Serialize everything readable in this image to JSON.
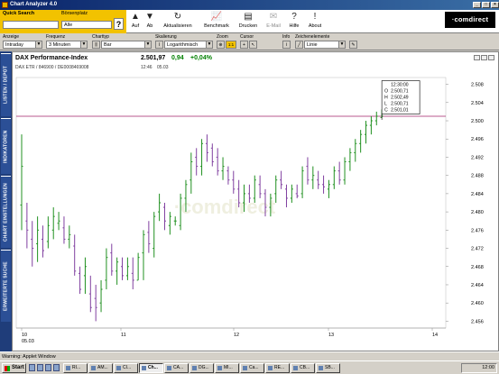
{
  "window": {
    "title": "Chart Analyzer 4.0"
  },
  "quicksearch": {
    "label": "Quick Search",
    "boersenplatz_label": "Börsenplatz",
    "search_value": "",
    "boersenplatz_value": "Alle",
    "help_label": "?"
  },
  "toolbar": {
    "buttons": [
      {
        "label": "Auf",
        "icon": "arrow-up-icon"
      },
      {
        "label": "Ab",
        "icon": "arrow-down-icon"
      },
      {
        "label": "Aktualisieren",
        "icon": "refresh-icon"
      },
      {
        "label": "Benchmark",
        "icon": "chart-icon"
      },
      {
        "label": "Drucken",
        "icon": "printer-icon"
      },
      {
        "label": "E-Mail",
        "icon": "email-icon"
      },
      {
        "label": "Hilfe",
        "icon": "help-icon"
      },
      {
        "label": "About",
        "icon": "about-icon"
      }
    ],
    "logo": "comdirect"
  },
  "settings": {
    "anzeige": {
      "label": "Anzeige",
      "value": "Intraday"
    },
    "frequenz": {
      "label": "Frequenz",
      "value": "3 Minuten"
    },
    "charttyp": {
      "label": "Charttyp",
      "value": "Bar"
    },
    "skalierung": {
      "label": "Skalierung",
      "value": "Logarithmisch"
    },
    "zoom": {
      "label": "Zoom",
      "value": "1:1"
    },
    "cursor": {
      "label": "Cursor"
    },
    "info": {
      "label": "Info"
    },
    "zeichenelemente": {
      "label": "Zeichenelemente",
      "value": "Linie"
    }
  },
  "sidebar": {
    "tabs": [
      "LISTEN / DEPOT",
      "INDIKATOREN",
      "CHART EINSTELLUNGEN",
      "ERWEITERTE SUCHE"
    ]
  },
  "instrument": {
    "name": "DAX Performance-Index",
    "sub": "DAX ETR / 846900 / DE0008469008",
    "price": "2.501,97",
    "change_abs": "0,94",
    "change_pct": "+0,04%",
    "time": "12:46",
    "date": "05.03"
  },
  "chart_data": {
    "type": "ohlc-bar",
    "watermark": "comdirect",
    "x_tick_labels": [
      "10",
      "05.03",
      "11",
      "12",
      "13",
      "14"
    ],
    "y_tick_labels": [
      "2.508",
      "2.504",
      "2.500",
      "2.496",
      "2.492",
      "2.488",
      "2.484",
      "2.480",
      "2.476",
      "2.472",
      "2.468",
      "2.464",
      "2.460",
      "2.456"
    ],
    "ylim": [
      2454.5,
      2509.5
    ],
    "reference_line": 2501.0,
    "tooltip": {
      "time": "12:30:00",
      "o": "2.500,71",
      "h": "2.502,49",
      "l": "2.500,71",
      "c": "2.501,01",
      "o_label": "O",
      "h_label": "H",
      "l_label": "L",
      "c_label": "C"
    },
    "bars": [
      [
        2481.5,
        2497.0,
        2476.0,
        2490.0
      ],
      [
        2478.0,
        2482.0,
        2472.0,
        2476.0
      ],
      [
        2474.0,
        2478.0,
        2468.0,
        2472.0
      ],
      [
        2473.0,
        2479.0,
        2469.0,
        2476.0
      ],
      [
        2474.0,
        2477.0,
        2470.0,
        2471.5
      ],
      [
        2473.5,
        2479.0,
        2472.0,
        2477.0
      ],
      [
        2476.0,
        2481.0,
        2474.0,
        2479.0
      ],
      [
        2477.5,
        2480.0,
        2476.0,
        2478.0
      ],
      [
        2476.5,
        2479.0,
        2473.0,
        2474.0
      ],
      [
        2474.0,
        2477.0,
        2472.0,
        2475.0
      ],
      [
        2472.5,
        2475.0,
        2466.0,
        2467.0
      ],
      [
        2466.5,
        2468.0,
        2462.0,
        2463.0
      ],
      [
        2466.0,
        2470.0,
        2462.0,
        2468.0
      ],
      [
        2462.0,
        2466.0,
        2458.0,
        2459.0
      ],
      [
        2461.0,
        2464.0,
        2456.0,
        2459.0
      ],
      [
        2460.0,
        2465.0,
        2458.0,
        2463.0
      ],
      [
        2465.0,
        2472.0,
        2463.0,
        2470.0
      ],
      [
        2471.0,
        2473.0,
        2466.0,
        2467.0
      ],
      [
        2467.0,
        2470.0,
        2464.0,
        2469.0
      ],
      [
        2468.0,
        2470.0,
        2465.0,
        2466.0
      ],
      [
        2466.0,
        2470.0,
        2465.0,
        2468.0
      ],
      [
        2466.5,
        2470.0,
        2463.0,
        2465.0
      ],
      [
        2465.0,
        2471.0,
        2465.0,
        2470.0
      ],
      [
        2471.0,
        2476.0,
        2465.0,
        2475.0
      ],
      [
        2475.5,
        2478.0,
        2471.0,
        2473.0
      ],
      [
        2472.0,
        2480.0,
        2470.0,
        2479.0
      ],
      [
        2480.0,
        2484.0,
        2478.0,
        2482.0
      ],
      [
        2481.0,
        2482.0,
        2476.0,
        2478.0
      ],
      [
        2477.0,
        2480.0,
        2475.0,
        2479.0
      ],
      [
        2478.0,
        2479.0,
        2477.0,
        2478.0
      ],
      [
        2477.0,
        2484.0,
        2476.0,
        2483.0
      ],
      [
        2483.0,
        2487.0,
        2480.0,
        2486.0
      ],
      [
        2487.0,
        2493.0,
        2484.0,
        2491.0
      ],
      [
        2492.0,
        2494.0,
        2488.0,
        2490.0
      ],
      [
        2490.0,
        2496.0,
        2488.0,
        2495.0
      ],
      [
        2495.0,
        2497.0,
        2491.0,
        2493.0
      ],
      [
        2494.0,
        2495.0,
        2490.0,
        2491.0
      ],
      [
        2492.0,
        2494.0,
        2488.0,
        2489.0
      ],
      [
        2489.0,
        2492.0,
        2487.0,
        2490.0
      ],
      [
        2489.0,
        2490.0,
        2486.0,
        2487.0
      ],
      [
        2487.0,
        2489.0,
        2484.0,
        2485.0
      ],
      [
        2485.0,
        2487.0,
        2481.0,
        2482.0
      ],
      [
        2482.0,
        2486.0,
        2480.0,
        2484.0
      ],
      [
        2484.0,
        2486.0,
        2482.0,
        2483.0
      ],
      [
        2483.0,
        2488.0,
        2482.0,
        2487.0
      ],
      [
        2486.0,
        2488.0,
        2483.0,
        2484.0
      ],
      [
        2484.0,
        2485.0,
        2479.0,
        2481.0
      ],
      [
        2481.0,
        2484.0,
        2479.0,
        2483.0
      ],
      [
        2484.0,
        2488.0,
        2482.0,
        2487.0
      ],
      [
        2487.0,
        2489.0,
        2485.0,
        2486.0
      ],
      [
        2485.0,
        2486.0,
        2481.0,
        2483.0
      ],
      [
        2483.0,
        2486.0,
        2482.0,
        2485.0
      ],
      [
        2484.0,
        2486.0,
        2483.0,
        2483.5
      ],
      [
        2484.0,
        2490.0,
        2483.0,
        2489.0
      ],
      [
        2490.0,
        2492.0,
        2486.0,
        2487.0
      ],
      [
        2487.0,
        2490.0,
        2485.0,
        2488.0
      ],
      [
        2487.0,
        2489.0,
        2485.0,
        2486.0
      ],
      [
        2486.0,
        2488.0,
        2484.0,
        2485.5
      ],
      [
        2485.0,
        2487.0,
        2483.0,
        2486.0
      ],
      [
        2486.0,
        2490.0,
        2485.0,
        2489.0
      ],
      [
        2489.0,
        2491.0,
        2486.0,
        2487.0
      ],
      [
        2487.0,
        2492.0,
        2486.0,
        2491.0
      ],
      [
        2491.0,
        2494.0,
        2489.0,
        2493.0
      ],
      [
        2493.0,
        2496.0,
        2491.0,
        2495.0
      ],
      [
        2495.0,
        2498.0,
        2493.0,
        2497.0
      ],
      [
        2497.0,
        2500.0,
        2495.0,
        2499.0
      ],
      [
        2499.0,
        2501.0,
        2497.0,
        2500.0
      ],
      [
        2500.0,
        2502.0,
        2499.0,
        2501.0
      ],
      [
        2500.71,
        2502.49,
        2500.71,
        2501.01
      ]
    ]
  },
  "status": {
    "text": "Warning: Applet Window"
  },
  "taskbar": {
    "start_label": "Start",
    "tasks": [
      "RI...",
      "AM...",
      "CI...",
      "Ch...",
      "CA...",
      "DG...",
      "MI...",
      "Ca...",
      "RE...",
      "CB...",
      "SB..."
    ],
    "active_task": 3,
    "clock": "12:00"
  }
}
